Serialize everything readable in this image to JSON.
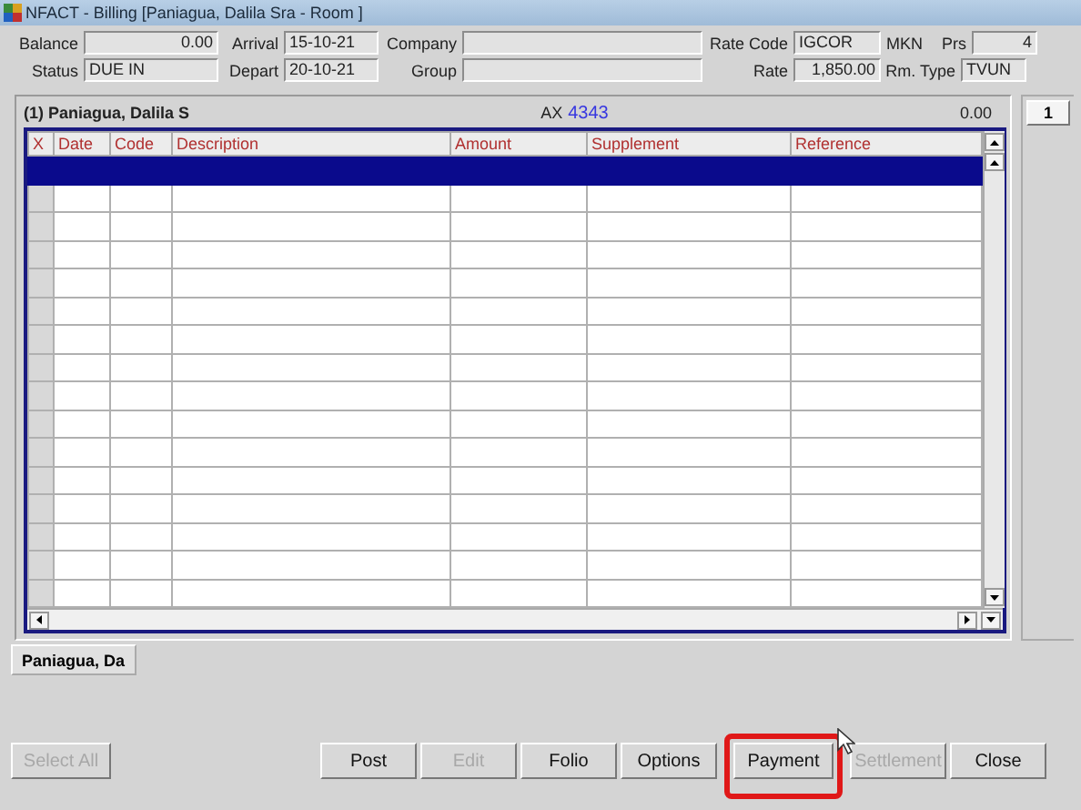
{
  "window": {
    "title": "NFACT - Billing [Paniagua, Dalila Sra - Room ]"
  },
  "header": {
    "rows": [
      [
        {
          "kind": "label",
          "text": "Balance"
        },
        {
          "kind": "number_field",
          "value": "0.00"
        },
        {
          "kind": "label",
          "text": "Arrival"
        },
        {
          "kind": "field",
          "value": "15-10-21"
        },
        {
          "kind": "label",
          "text": "Company"
        },
        {
          "kind": "field"
        },
        {
          "kind": "label",
          "text": "Rate Code"
        },
        {
          "kind": "field",
          "value": "IGCOR"
        },
        {
          "kind": "label",
          "text": "MKN"
        },
        {
          "kind": "label",
          "text": "Prs"
        },
        {
          "kind": "number_field",
          "value": "4"
        }
      ],
      [
        {
          "kind": "label",
          "text": "Status"
        },
        {
          "kind": "field",
          "value": "DUE IN"
        },
        {
          "kind": "label",
          "text": "Depart"
        },
        {
          "kind": "field",
          "value": "20-10-21"
        },
        {
          "kind": "label",
          "text": "Group"
        },
        {
          "kind": "field"
        },
        {
          "kind": "label",
          "text": "Rate"
        },
        {
          "kind": "number_field",
          "value": "1,850.00"
        },
        {
          "kind": "label",
          "text": "Rm. Type"
        },
        {
          "kind": "field",
          "value": "TVUN"
        }
      ]
    ]
  },
  "folio": {
    "guest": "(1) Paniagua, Dalila S",
    "payment_code": "AX",
    "payment_number": "4343",
    "total": "0.00",
    "table": {
      "columns": [
        "X",
        "Date",
        "Code",
        "Description",
        "Amount",
        "Supplement",
        "Reference"
      ],
      "rows": [
        {
          "selected": true
        },
        {
          "selected": false
        },
        {
          "selected": false
        },
        {
          "selected": false
        },
        {
          "selected": false
        },
        {
          "selected": false
        },
        {
          "selected": false
        },
        {
          "selected": false
        },
        {
          "selected": false
        },
        {
          "selected": false
        },
        {
          "selected": false
        },
        {
          "selected": false
        },
        {
          "selected": false
        },
        {
          "selected": false
        },
        {
          "selected": false
        },
        {
          "selected": false
        }
      ]
    }
  },
  "window_tabs": [
    {
      "label": "1",
      "selected": true
    }
  ],
  "guest_tabs": [
    {
      "label": "Paniagua, Da",
      "selected": true
    }
  ],
  "buttons": [
    {
      "label": "Select All",
      "disabled": true,
      "highlighted": false
    },
    {
      "label": "Post",
      "disabled": false,
      "highlighted": false
    },
    {
      "label": "Edit",
      "disabled": true,
      "highlighted": false
    },
    {
      "label": "Folio",
      "disabled": false,
      "highlighted": false
    },
    {
      "label": "Options",
      "disabled": false,
      "highlighted": false
    },
    {
      "label": "Payment",
      "disabled": false,
      "highlighted": true
    },
    {
      "label": "Settlement",
      "disabled": true,
      "highlighted": false
    },
    {
      "label": "Close",
      "disabled": false,
      "highlighted": false
    }
  ]
}
